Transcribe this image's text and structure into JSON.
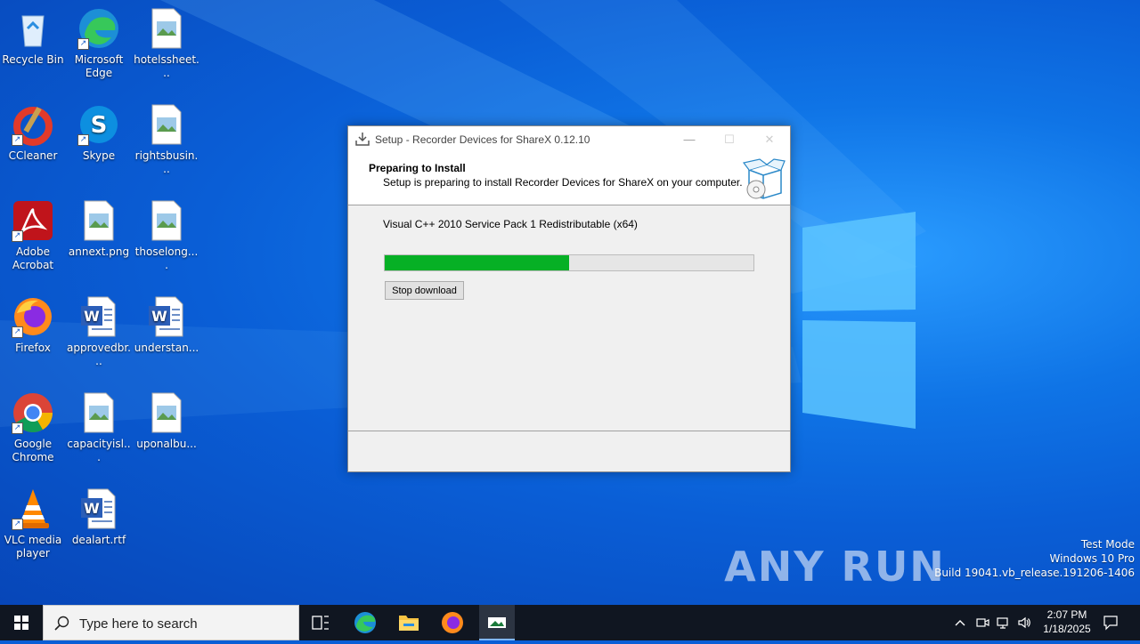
{
  "desktop": {
    "icons": [
      {
        "label": "Recycle Bin"
      },
      {
        "label": "Microsoft Edge"
      },
      {
        "label": "hotelssheet..."
      },
      {
        "label": "CCleaner"
      },
      {
        "label": "Skype"
      },
      {
        "label": "rightsbusin..."
      },
      {
        "label": "Adobe Acrobat"
      },
      {
        "label": "annext.png"
      },
      {
        "label": "thoselong...."
      },
      {
        "label": "Firefox"
      },
      {
        "label": "approvedbr..."
      },
      {
        "label": "understan..."
      },
      {
        "label": "Google Chrome"
      },
      {
        "label": "capacityisl..."
      },
      {
        "label": "uponalbu..."
      },
      {
        "label": "VLC media player"
      },
      {
        "label": "dealart.rtf"
      }
    ]
  },
  "dialog": {
    "title": "Setup - Recorder Devices for ShareX 0.12.10",
    "heading": "Preparing to Install",
    "subheading": "Setup is preparing to install Recorder Devices for ShareX on your computer.",
    "current_item": "Visual C++ 2010 Service Pack 1 Redistributable (x64)",
    "progress_fraction": 0.5,
    "stop_button": "Stop download",
    "buttons": {
      "minimize": "—",
      "maximize": "☐",
      "close": "✕"
    }
  },
  "watermark": {
    "brand": "ANY RUN",
    "line1": "Test Mode",
    "line2": "Windows 10 Pro",
    "line3": "Build 19041.vb_release.191206-1406"
  },
  "taskbar": {
    "search_placeholder": "Type here to search",
    "time": "2:07 PM",
    "date": "1/18/2025"
  },
  "colors": {
    "progress_green": "#06b025",
    "desktop_blue": "#0a5ed6",
    "taskbar": "#101621"
  }
}
